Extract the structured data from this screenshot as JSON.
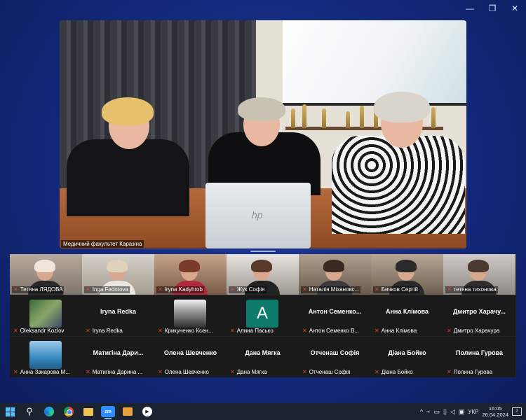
{
  "window_controls": {
    "minimize": "—",
    "restore": "❐",
    "close": "✕"
  },
  "main_video": {
    "label": "Медичний факультет Каразіна",
    "laptop_logo": "hp"
  },
  "gallery": {
    "tiles": [
      {
        "name": "Тетяна ЛЯДОВА",
        "kind": "video",
        "variant": "v1"
      },
      {
        "name": "Inga Fedotova",
        "kind": "video",
        "variant": "v2"
      },
      {
        "name": "Iryna Kadyhrob",
        "kind": "video",
        "variant": "v3"
      },
      {
        "name": "Жук Софія",
        "kind": "video",
        "variant": "v4"
      },
      {
        "name": "Наталія Міхановс...",
        "kind": "video",
        "variant": "v5"
      },
      {
        "name": "Бичков Сергій",
        "kind": "video",
        "variant": "v6"
      },
      {
        "name": "тетяна тихонова",
        "kind": "video",
        "variant": "v7"
      },
      {
        "name": "Oleksandr Kozlov",
        "kind": "avatar",
        "avatar": "av1"
      },
      {
        "name": "Iryna Redka",
        "display": "Iryna Redka",
        "kind": "text"
      },
      {
        "name": "Крикуненко Ксен...",
        "kind": "avatar",
        "avatar": "av2"
      },
      {
        "name": "Алина Пасько",
        "kind": "avatar",
        "avatar": "av3",
        "initial": "A"
      },
      {
        "name": "Антон Семенко В...",
        "display": "Антон  Семенко...",
        "kind": "text"
      },
      {
        "name": "Анна Клімова",
        "display": "Анна Клімова",
        "kind": "text"
      },
      {
        "name": "Дмитро Харачура",
        "display": "Дмитро  Харачу...",
        "kind": "text"
      },
      {
        "name": "Анна Закарова М...",
        "kind": "avatar",
        "avatar": "av4"
      },
      {
        "name": "Матигіна Дарина ...",
        "display": "Матигіна  Дари...",
        "kind": "text"
      },
      {
        "name": "Олена Шевченко",
        "display": "Олена Шевченко",
        "kind": "text"
      },
      {
        "name": "Дана Мягка",
        "display": "Дана Мягка",
        "kind": "text"
      },
      {
        "name": "Отченаш Софія",
        "display": "Отченаш Софія",
        "kind": "text"
      },
      {
        "name": "Діана Бойко",
        "display": "Діана Бойко",
        "kind": "text"
      },
      {
        "name": "Полина Гурова",
        "display": "Полина Гурова",
        "kind": "text"
      }
    ]
  },
  "taskbar": {
    "zoom_label": "zm",
    "tray": {
      "chevron": "^",
      "lang": "УКР",
      "time": "16:05",
      "date": "26.04.2024",
      "notifications": "2"
    }
  }
}
